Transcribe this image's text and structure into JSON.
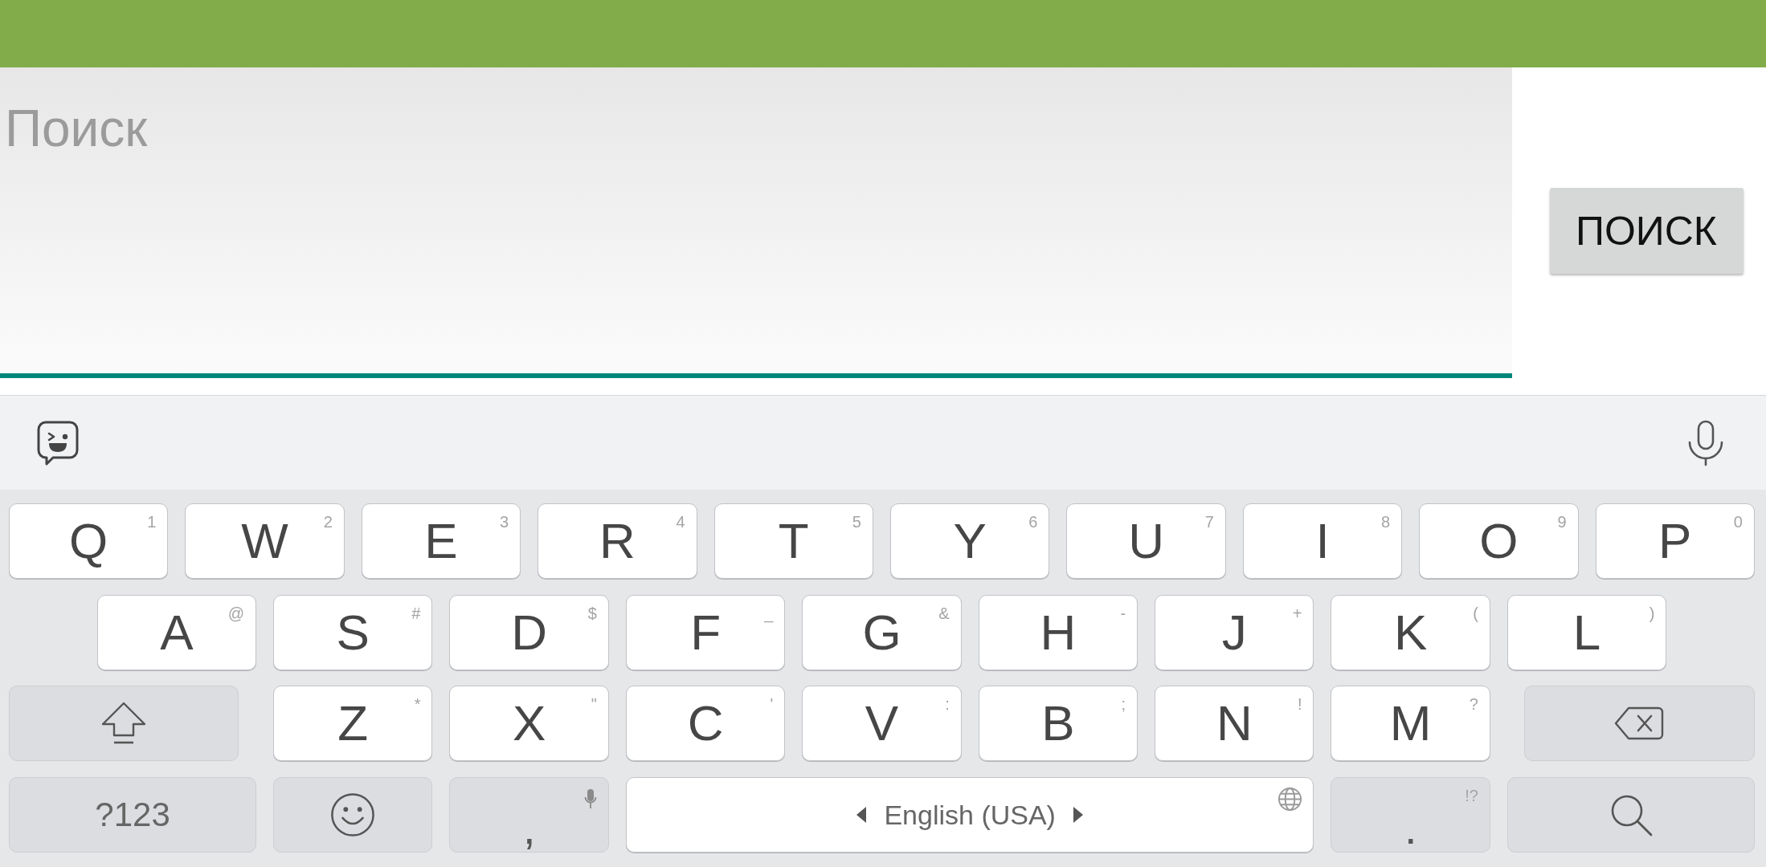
{
  "search": {
    "placeholder": "Поиск",
    "button": "ПОИСК"
  },
  "keyboard": {
    "key_rows": [
      {
        "keys": [
          {
            "kind": "char",
            "label": "Q",
            "hint": "1"
          },
          {
            "kind": "char",
            "label": "W",
            "hint": "2"
          },
          {
            "kind": "char",
            "label": "E",
            "hint": "3"
          },
          {
            "kind": "char",
            "label": "R",
            "hint": "4"
          },
          {
            "kind": "char",
            "label": "T",
            "hint": "5"
          },
          {
            "kind": "char",
            "label": "Y",
            "hint": "6"
          },
          {
            "kind": "char",
            "label": "U",
            "hint": "7"
          },
          {
            "kind": "char",
            "label": "I",
            "hint": "8"
          },
          {
            "kind": "char",
            "label": "O",
            "hint": "9"
          },
          {
            "kind": "char",
            "label": "P",
            "hint": "0"
          }
        ]
      },
      {
        "keys": [
          {
            "kind": "char",
            "label": "A",
            "hint": "@"
          },
          {
            "kind": "char",
            "label": "S",
            "hint": "#"
          },
          {
            "kind": "char",
            "label": "D",
            "hint": "$"
          },
          {
            "kind": "char",
            "label": "F",
            "hint": "_"
          },
          {
            "kind": "char",
            "label": "G",
            "hint": "&"
          },
          {
            "kind": "char",
            "label": "H",
            "hint": "-"
          },
          {
            "kind": "char",
            "label": "J",
            "hint": "+"
          },
          {
            "kind": "char",
            "label": "K",
            "hint": "("
          },
          {
            "kind": "char",
            "label": "L",
            "hint": ")"
          }
        ]
      },
      {
        "keys": [
          {
            "kind": "shift"
          },
          {
            "kind": "char",
            "label": "Z",
            "hint": "*"
          },
          {
            "kind": "char",
            "label": "X",
            "hint": "\""
          },
          {
            "kind": "char",
            "label": "C",
            "hint": "'"
          },
          {
            "kind": "char",
            "label": "V",
            "hint": ":"
          },
          {
            "kind": "char",
            "label": "B",
            "hint": ";"
          },
          {
            "kind": "char",
            "label": "N",
            "hint": "!"
          },
          {
            "kind": "char",
            "label": "M",
            "hint": "?"
          },
          {
            "kind": "backspace"
          }
        ]
      },
      {
        "keys": [
          {
            "kind": "symbols",
            "label": "?123"
          },
          {
            "kind": "emoji"
          },
          {
            "kind": "comma",
            "label": ","
          },
          {
            "kind": "space",
            "label": "English (USA)"
          },
          {
            "kind": "period",
            "label": ".",
            "hint": "!?"
          },
          {
            "kind": "search"
          }
        ]
      }
    ]
  }
}
